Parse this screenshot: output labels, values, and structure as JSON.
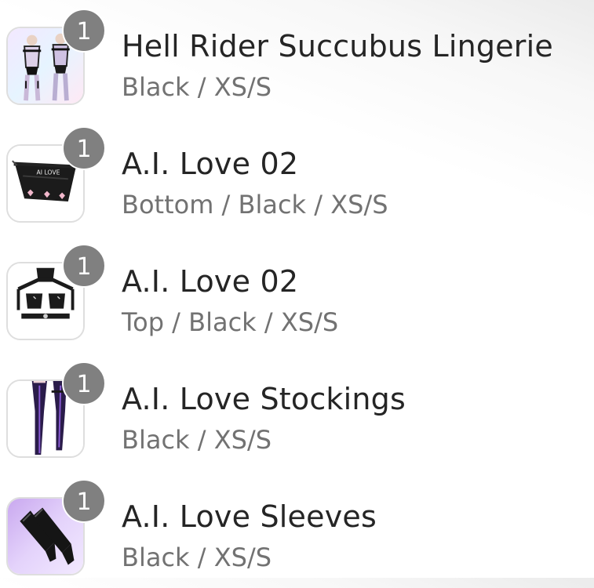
{
  "cart": {
    "items": [
      {
        "quantity": "1",
        "title": "Hell Rider Succubus Lingerie",
        "variant": "Black / XS/S",
        "thumbnail_icon": "lingerie-set-thumbnail"
      },
      {
        "quantity": "1",
        "title": "A.I. Love 02",
        "variant": "Bottom / Black / XS/S",
        "thumbnail_icon": "skirt-bottom-thumbnail"
      },
      {
        "quantity": "1",
        "title": "A.I. Love 02",
        "variant": "Top / Black / XS/S",
        "thumbnail_icon": "harness-top-thumbnail"
      },
      {
        "quantity": "1",
        "title": "A.I. Love Stockings",
        "variant": "Black / XS/S",
        "thumbnail_icon": "stockings-thumbnail"
      },
      {
        "quantity": "1",
        "title": "A.I. Love Sleeves",
        "variant": "Black / XS/S",
        "thumbnail_icon": "sleeves-thumbnail"
      }
    ]
  },
  "colors": {
    "badge": "#808080",
    "title": "#252525",
    "variant": "#727272",
    "thumb_border": "#dedede"
  }
}
